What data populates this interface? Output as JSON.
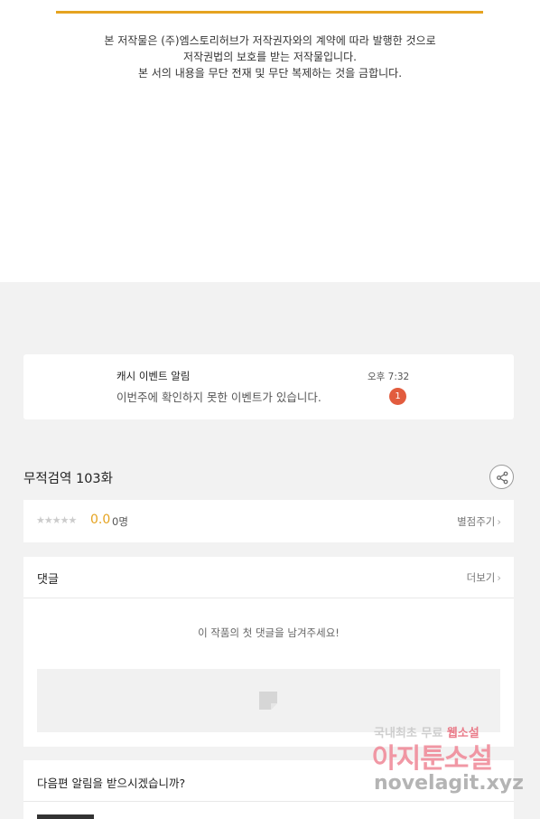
{
  "copyright": {
    "lines": [
      "본 저작물은 (주)엠스토리허브가 저작권자와의 계약에 따라 발행한 것으로",
      "저작권법의 보호를 받는 저작물입니다.",
      "본 서의 내용을 무단 전재 및 무단 복제하는 것을 금합니다."
    ],
    "accent_color": "#e5a320"
  },
  "notification": {
    "title": "캐시 이벤트 알림",
    "body": "이번주에 확인하지 못한 이벤트가 있습니다.",
    "time": "오후 7:32",
    "badge": "1",
    "badge_color": "#e25c3e"
  },
  "episode": {
    "title": "무적검역 103화",
    "share_icon": "share-icon"
  },
  "rating": {
    "stars": "★★★★★",
    "score": "0.0",
    "count": "0명",
    "rate_label": "별점주기",
    "chevron": "›"
  },
  "comments": {
    "header": "댓글",
    "more_label": "더보기",
    "chevron": "›",
    "empty_text": "이 작품의 첫 댓글을 남겨주세요!"
  },
  "next_alert": {
    "question": "다음편 알림을 받으시겠습니까?"
  },
  "watermark": {
    "line1_a": "국내최초 무료",
    "line1_b": "웹소설",
    "line2": "아지툰소설",
    "line3": "novelagit.xyz"
  }
}
